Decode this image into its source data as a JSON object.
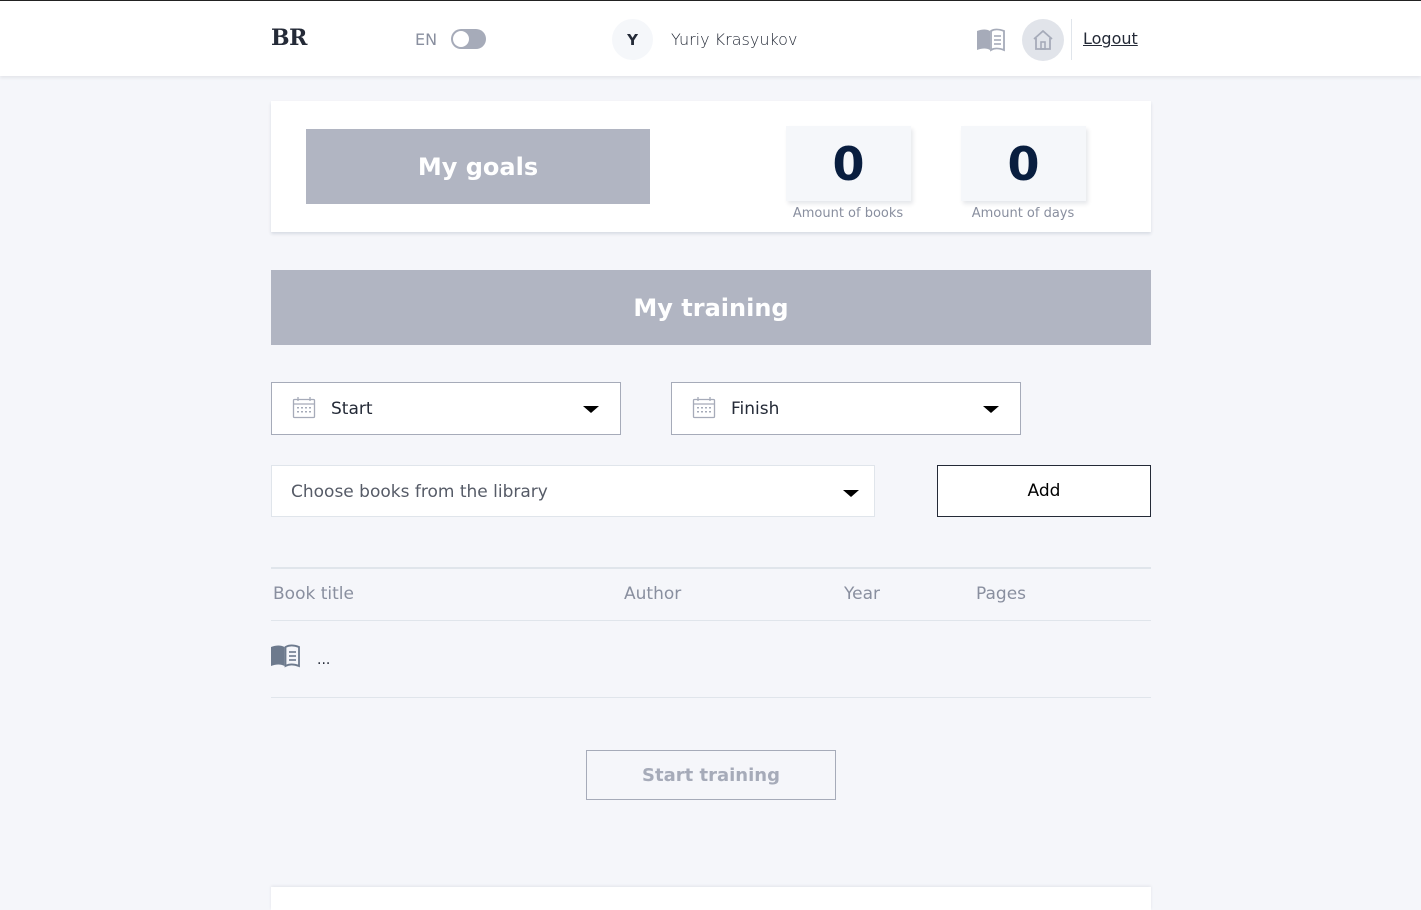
{
  "header": {
    "logo": "BR",
    "language": "EN",
    "avatar_initial": "Y",
    "user_name": "Yuriy Krasyukov",
    "logout_label": "Logout"
  },
  "goals": {
    "title": "My goals",
    "books_count": "0",
    "books_label": "Amount of books",
    "days_count": "0",
    "days_label": "Amount of days"
  },
  "training": {
    "title": "My training",
    "start_label": "Start",
    "finish_label": "Finish",
    "book_select_placeholder": "Choose books from the library",
    "add_label": "Add",
    "start_training_label": "Start training"
  },
  "table": {
    "columns": [
      "Book title",
      "Author",
      "Year",
      "Pages"
    ],
    "empty_row_text": "..."
  },
  "colors": {
    "accent_grey": "#b1b5c2",
    "background": "#f5f6fa",
    "text_dark": "#242a37",
    "text_muted": "#898f9f"
  }
}
